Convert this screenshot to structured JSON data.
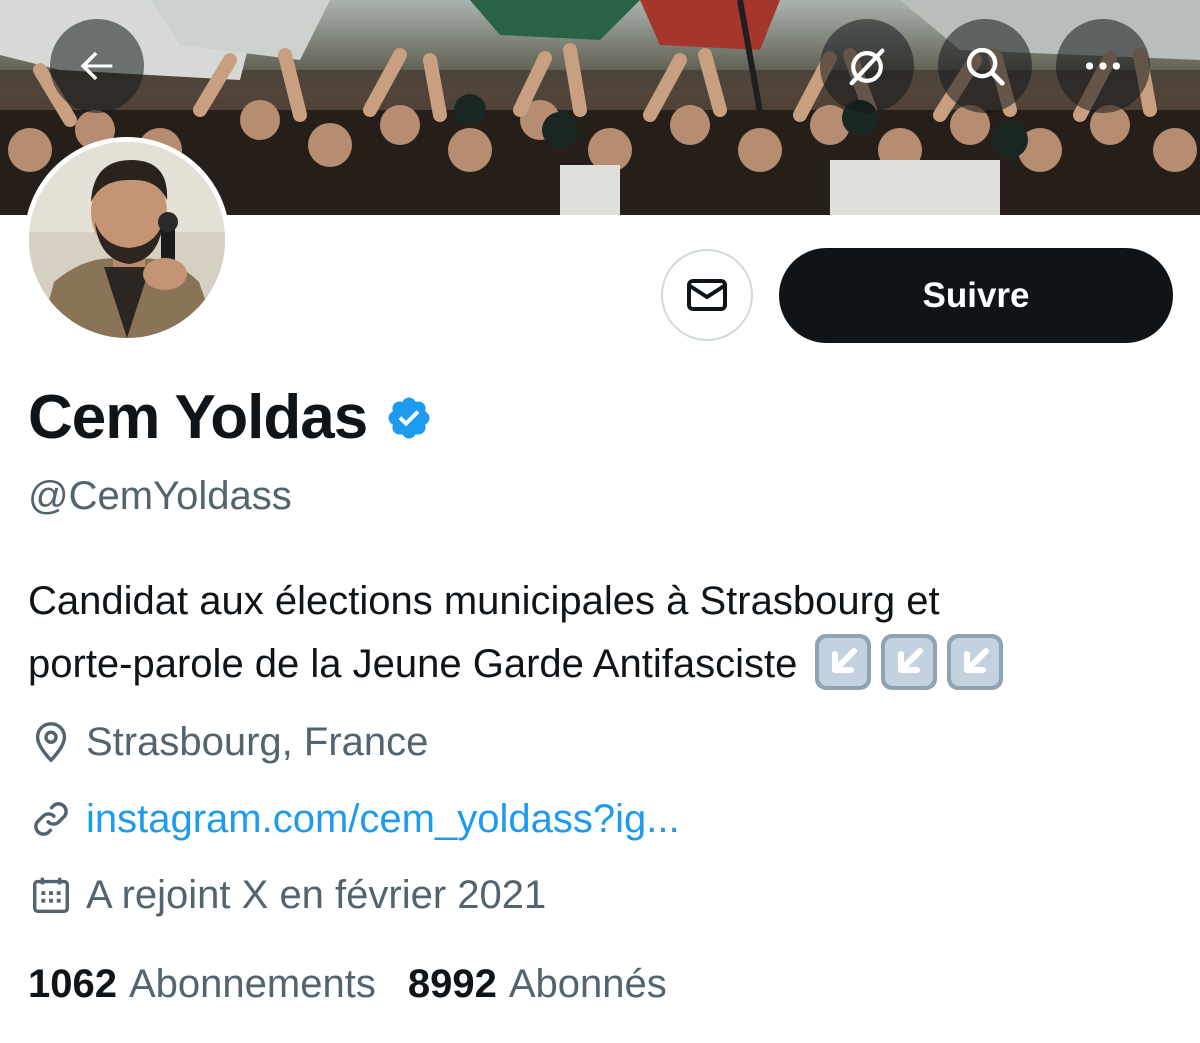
{
  "header": {
    "back_icon": "arrow-left-icon",
    "grok_icon": "slashed-circle-icon",
    "search_icon": "search-icon",
    "more_icon": "more-dots-icon"
  },
  "actions": {
    "message_icon": "envelope-icon",
    "follow_label": "Suivre"
  },
  "profile": {
    "name": "Cem Yoldas",
    "verified_icon": "verified-badge-icon",
    "handle": "@CemYoldass",
    "bio_line1": "Candidat aux élections municipales à Strasbourg et",
    "bio_line2": "porte-parole de la Jeune Garde Antifasciste",
    "bio_emoji": [
      "arrow-down-left-emoji",
      "arrow-down-left-emoji",
      "arrow-down-left-emoji"
    ],
    "location": "Strasbourg, France",
    "website": "instagram.com/cem_yoldass?ig...",
    "joined": "A rejoint X en février 2021"
  },
  "stats": {
    "following_count": "1062",
    "following_label": "Abonnements",
    "followers_count": "8992",
    "followers_label": "Abonnés"
  },
  "colors": {
    "accent": "#1d9bf0",
    "text_primary": "#0f1419",
    "text_secondary": "#536471",
    "follow_bg": "#0f1419"
  }
}
